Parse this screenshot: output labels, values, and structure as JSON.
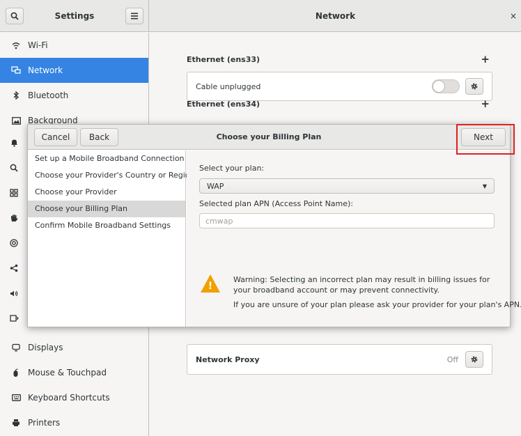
{
  "header": {
    "app_title": "Settings",
    "panel_title": "Network",
    "search_icon": "search-icon",
    "menu_icon": "hamburger-menu-icon",
    "close_glyph": "×"
  },
  "sidebar": {
    "items": [
      {
        "label": "Wi-Fi",
        "icon": "wifi-icon"
      },
      {
        "label": "Network",
        "icon": "network-wired-icon",
        "selected": true
      },
      {
        "label": "Bluetooth",
        "icon": "bluetooth-icon"
      },
      {
        "label": "Background",
        "icon": "background-icon"
      },
      {
        "label": "Displays",
        "icon": "display-icon"
      },
      {
        "label": "Mouse & Touchpad",
        "icon": "mouse-icon"
      },
      {
        "label": "Keyboard Shortcuts",
        "icon": "keyboard-icon"
      },
      {
        "label": "Printers",
        "icon": "printer-icon"
      }
    ]
  },
  "main": {
    "ethernet1": {
      "title": "Ethernet (ens33)",
      "status": "Cable unplugged"
    },
    "ethernet2": {
      "title": "Ethernet (ens34)"
    },
    "proxy": {
      "title": "Network Proxy",
      "status": "Off"
    },
    "add_glyph": "+"
  },
  "dialog": {
    "title": "Choose your Billing Plan",
    "cancel_label": "Cancel",
    "back_label": "Back",
    "next_label": "Next",
    "steps": [
      "Set up a Mobile Broadband Connection",
      "Choose your Provider's Country or Region",
      "Choose your Provider",
      "Choose your Billing Plan",
      "Confirm Mobile Broadband Settings"
    ],
    "current_step": 3,
    "plan_label": "Select your plan:",
    "plan_value": "WAP",
    "apn_label": "Selected plan APN (Access Point Name):",
    "apn_value": "cmwap",
    "warning_text": "Warning: Selecting an incorrect plan may result in billing issues for your broadband account or may prevent connectivity.",
    "hint_text": "If you are unsure of your plan please ask your provider for your plan's APN."
  },
  "colors": {
    "accent": "#3584e4",
    "warning": "#f0a000",
    "highlight": "#e02020"
  }
}
